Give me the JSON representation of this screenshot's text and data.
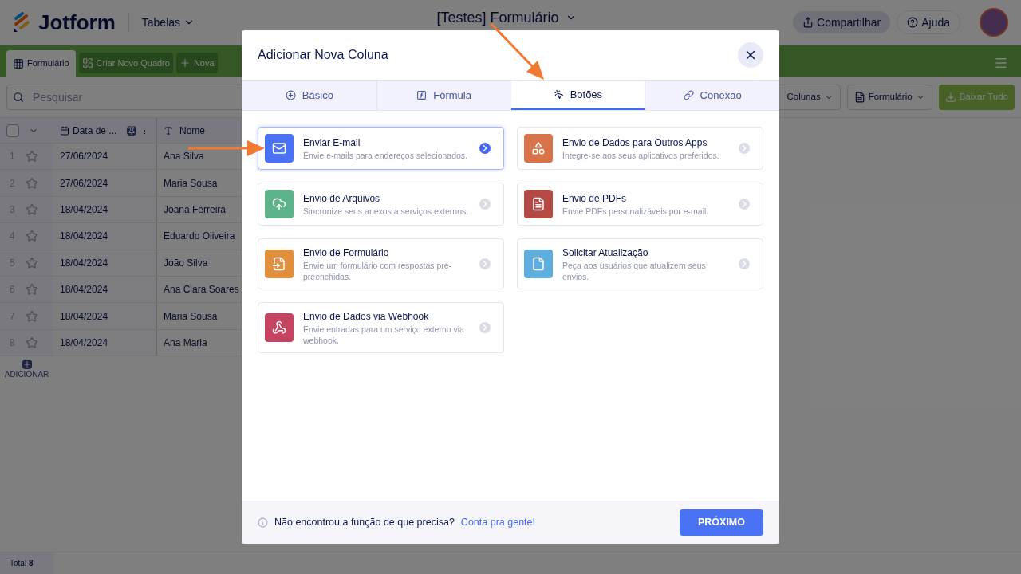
{
  "header": {
    "logo": "Jotform",
    "section": "Tabelas",
    "title": "[Testes] Formulário",
    "share": "Compartilhar",
    "help": "Ajuda"
  },
  "tabs_bar": {
    "tabs": [
      {
        "label": "Formulário",
        "selected": true
      },
      {
        "label": "Criar Novo Quadro",
        "selected": false
      },
      {
        "label": "Nova",
        "selected": false
      }
    ]
  },
  "toolbar": {
    "search": {
      "placeholder": "Pesquisar"
    },
    "columns": "Colunas",
    "view": "Formulário",
    "download": "Baixar Tudo"
  },
  "table": {
    "columns": [
      "Data de ...",
      "Nome"
    ],
    "rows": [
      {
        "number": "1",
        "starred": false,
        "date": "27/06/2024",
        "name": "Ana Silva"
      },
      {
        "number": "2",
        "starred": false,
        "date": "27/06/2024",
        "name": "Maria Sousa"
      },
      {
        "number": "3",
        "starred": false,
        "date": "18/04/2024",
        "name": "Joana Ferreira"
      },
      {
        "number": "4",
        "starred": false,
        "date": "18/04/2024",
        "name": "Eduardo Oliveira"
      },
      {
        "number": "5",
        "starred": false,
        "date": "18/04/2024",
        "name": "João Silva"
      },
      {
        "number": "6",
        "starred": false,
        "date": "18/04/2024",
        "name": "Ana Clara Soares"
      },
      {
        "number": "7",
        "starred": false,
        "date": "18/04/2024",
        "name": "Maria Sousa"
      },
      {
        "number": "8",
        "starred": false,
        "date": "18/04/2024",
        "name": "Ana Maria"
      }
    ],
    "add": "ADICIONAR",
    "select_all": {
      "checked": false
    }
  },
  "status_bar": {
    "total": "Total **8**"
  },
  "dialog": {
    "title": "Adicionar Nova Coluna",
    "tabs": [
      {
        "label": "Básico",
        "selected": false
      },
      {
        "label": "Fórmula",
        "selected": false
      },
      {
        "label": "Botões",
        "selected": true
      },
      {
        "label": "Conexão",
        "selected": false
      }
    ],
    "options": [
      {
        "title": "Enviar E-mail",
        "description": "Envie e-mails para endereços selecionados.",
        "color": "#4a72f5",
        "selected": true
      },
      {
        "title": "Envio de Dados para Outros Apps",
        "description": "Integre-se aos seus aplicativos preferidos.",
        "color": "#d9744a",
        "selected": false
      },
      {
        "title": "Envio de Arquivos",
        "description": "Sincronize seus anexos a serviços externos.",
        "color": "#5db38a",
        "selected": false
      },
      {
        "title": "Envio de PDFs",
        "description": "Envie PDFs personalizáveis por e-mail.",
        "color": "#b54a44",
        "selected": false
      },
      {
        "title": "Envio de Formulário",
        "description": "Envie um formulário com respostas pré-preenchidas.",
        "color": "#e28f3d",
        "selected": false
      },
      {
        "title": "Solicitar Atualização",
        "description": "Peça aos usuários que atualizem seus envios.",
        "color": "#5faee0",
        "selected": false
      },
      {
        "title": "Envio de Dados via Webhook",
        "description": "Envie entradas para um serviço externo via webhook.",
        "color": "#c44462",
        "selected": false
      }
    ],
    "footer": {
      "question": "Não encontrou a função de que precisa?",
      "link": "Conta pra gente!",
      "next": "PRÓXIMO"
    }
  }
}
